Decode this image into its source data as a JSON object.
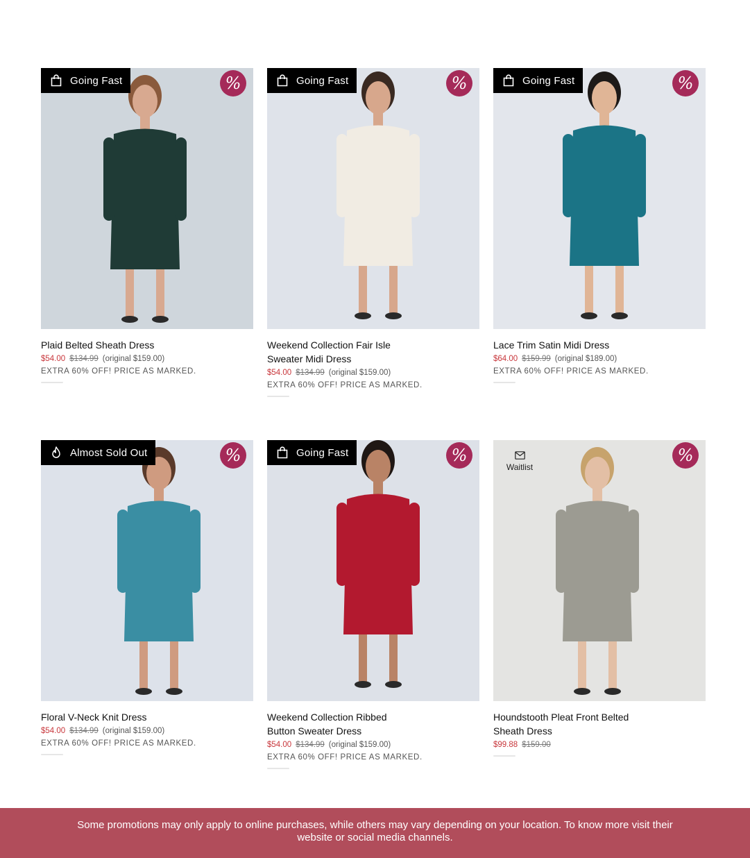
{
  "products": [
    {
      "badge": "Going Fast",
      "badge_icon": "shopping-bag-icon",
      "promo_icon": "%",
      "name": "Plaid Belted Sheath Dress",
      "sale_price": "$54.00",
      "list_price": "$134.99",
      "original_price": "(original $159.00)",
      "promo": "EXTRA 60% OFF! PRICE AS MARKED.",
      "colors": {
        "bg": "#cfd6dc",
        "dress": "#1f3b36",
        "skin": "#d8a990",
        "hair": "#8a5a3c"
      }
    },
    {
      "badge": "Going Fast",
      "badge_icon": "shopping-bag-icon",
      "promo_icon": "%",
      "name": "Weekend Collection Fair Isle Sweater Midi Dress",
      "sale_price": "$54.00",
      "list_price": "$134.99",
      "original_price": "(original $159.00)",
      "promo": "EXTRA 60% OFF! PRICE AS MARKED.",
      "colors": {
        "bg": "#dfe3ea",
        "dress": "#f1ece3",
        "skin": "#d7a78c",
        "hair": "#3a2a22"
      }
    },
    {
      "badge": "Going Fast",
      "badge_icon": "shopping-bag-icon",
      "promo_icon": "%",
      "name": "Lace Trim Satin Midi Dress",
      "sale_price": "$64.00",
      "list_price": "$159.99",
      "original_price": "(original $189.00)",
      "promo": "EXTRA 60% OFF! PRICE AS MARKED.",
      "colors": {
        "bg": "#e3e6ec",
        "dress": "#1b7486",
        "skin": "#e0b596",
        "hair": "#1e1a18"
      }
    },
    {
      "badge": "Almost Sold Out",
      "badge_icon": "flame-icon",
      "promo_icon": "%",
      "name": "Floral V-Neck Knit Dress",
      "sale_price": "$54.00",
      "list_price": "$134.99",
      "original_price": "(original $159.00)",
      "promo": "EXTRA 60% OFF! PRICE AS MARKED.",
      "colors": {
        "bg": "#dde2ea",
        "dress": "#3a8ea3",
        "skin": "#cf9b80",
        "hair": "#5a3a2a"
      }
    },
    {
      "badge": "Going Fast",
      "badge_icon": "shopping-bag-icon",
      "promo_icon": "%",
      "name": "Weekend Collection Ribbed Button Sweater Dress",
      "sale_price": "$54.00",
      "list_price": "$134.99",
      "original_price": "(original $159.00)",
      "promo": "EXTRA 60% OFF! PRICE AS MARKED.",
      "colors": {
        "bg": "#dde1e8",
        "dress": "#b3192f",
        "skin": "#b98366",
        "hair": "#1f1714"
      }
    },
    {
      "badge": "",
      "waitlist": "Waitlist",
      "waitlist_icon": "mail-icon",
      "promo_icon": "%",
      "name": "Houndstooth Pleat Front Belted Sheath Dress",
      "sale_price": "$99.88",
      "list_price": "$159.00",
      "original_price": "",
      "promo": "",
      "colors": {
        "bg": "#e4e4e2",
        "dress": "#9c9b92",
        "skin": "#e3bfa5",
        "hair": "#c7a36c"
      }
    }
  ],
  "footer": {
    "notice": "Some promotions may only apply to online purchases, while others may vary depending on your location. To know more visit their website or social media channels.",
    "color": "#b14d5b"
  },
  "accent": {
    "promo_circle": "#a52a59",
    "sale_price": "#c8363b",
    "badge_bg": "#000000"
  }
}
